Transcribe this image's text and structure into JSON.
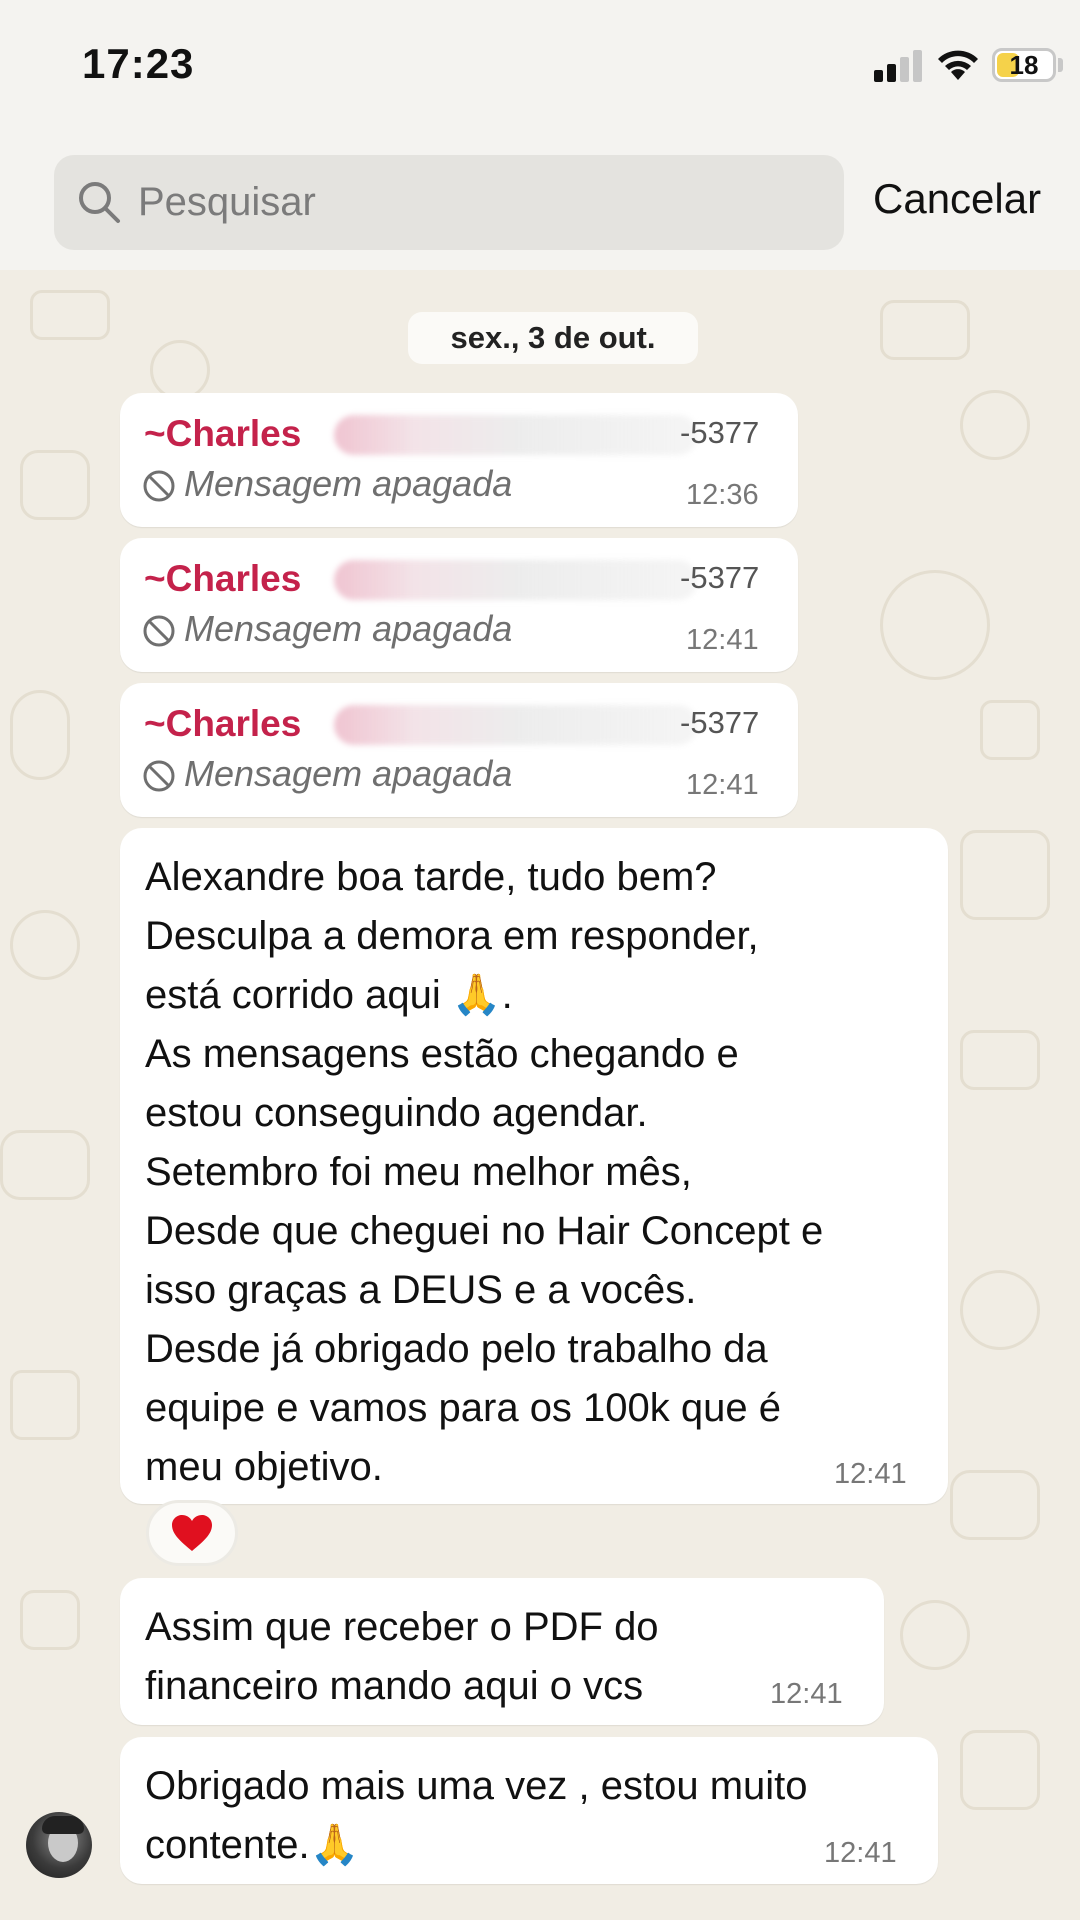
{
  "status_bar": {
    "time": "17:23",
    "battery": "18",
    "battery_color": "#f5d24a"
  },
  "search": {
    "placeholder": "Pesquisar",
    "cancel_label": "Cancelar"
  },
  "date_separator": "sex., 3 de out.",
  "deleted_messages": [
    {
      "sender": "~Charles",
      "phone": "-5377",
      "text": "Mensagem apagada",
      "time": "12:36"
    },
    {
      "sender": "~Charles",
      "phone": "-5377",
      "text": "Mensagem apagada",
      "time": "12:41"
    },
    {
      "sender": "~Charles",
      "phone": "-5377",
      "text": "Mensagem apagada",
      "time": "12:41"
    }
  ],
  "messages": [
    {
      "text": "Alexandre boa tarde, tudo bem?\nDesculpa a demora em responder,\nestá corrido aqui 🙏.\nAs mensagens estão chegando e\nestou conseguindo agendar.\nSetembro foi meu melhor mês,\nDesde que cheguei no Hair Concept e\nisso graças a DEUS e a vocês.\nDesde já obrigado pelo trabalho da\nequipe e vamos para os 100k que é\nmeu objetivo.",
      "time": "12:41",
      "reaction": "❤️"
    },
    {
      "text": "Assim que receber o PDF do\nfinanceiro mando aqui o vcs",
      "time": "12:41"
    },
    {
      "text": "Obrigado mais uma vez , estou muito\ncontente.🙏",
      "time": "12:41"
    }
  ],
  "colors": {
    "sender_name": "#c4224b",
    "wallpaper": "#f1ede4",
    "bubble": "#ffffff"
  }
}
